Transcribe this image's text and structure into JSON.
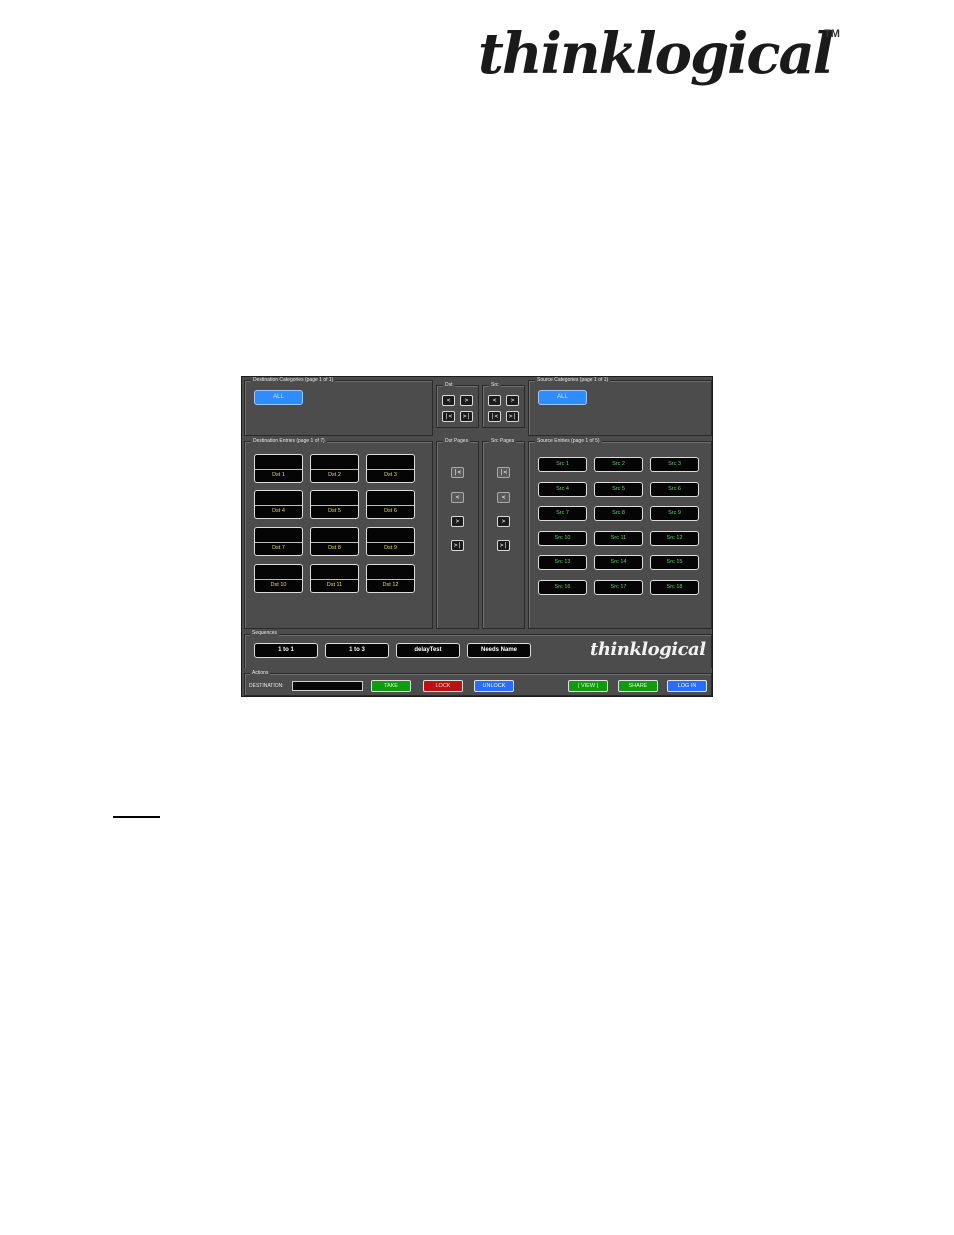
{
  "header": {
    "logo_text": "thinklogical",
    "tm": "TM"
  },
  "app": {
    "dest_categories": {
      "title": "Destination Categories (page 1 of 1)",
      "all_label": "ALL"
    },
    "dst_nav": {
      "title": "Dst",
      "buttons": [
        "<",
        ">",
        "|<",
        ">|"
      ]
    },
    "src_nav": {
      "title": "Src",
      "buttons": [
        "<",
        ">",
        "|<",
        ">|"
      ]
    },
    "source_categories": {
      "title": "Source Categories (page 1 of 1)",
      "all_label": "ALL"
    },
    "dest_entries": {
      "title": "Destination Entries (page 1 of 7)",
      "items": [
        "Dst 1",
        "Dst 2",
        "Dst 3",
        "Dst 4",
        "Dst 5",
        "Dst 6",
        "Dst 7",
        "Dst 8",
        "Dst 9",
        "Dst 10",
        "Dst 11",
        "Dst 12"
      ]
    },
    "dst_pages": {
      "title": "Dst Pages",
      "buttons": [
        "|<",
        "<",
        ">",
        ">|"
      ]
    },
    "src_pages": {
      "title": "Src Pages",
      "buttons": [
        "|<",
        "<",
        ">",
        ">|"
      ]
    },
    "source_entries": {
      "title": "Source Entries (page 1 of 5)",
      "items": [
        "Src 1",
        "Src 2",
        "Src 3",
        "Src 4",
        "Src 5",
        "Src 6",
        "Src 7",
        "Src 8",
        "Src 9",
        "Src 10",
        "Src 11",
        "Src 12",
        "Src 13",
        "Src 14",
        "Src 15",
        "Src 16",
        "Src 17",
        "Src 18"
      ]
    },
    "sequences": {
      "title": "Sequences",
      "items": [
        "1 to 1",
        "1 to 3",
        "delayTest",
        "Needs Name"
      ]
    },
    "brand": {
      "logo_text": "thinklogical",
      "tm": "TM"
    },
    "actions": {
      "title": "Actions",
      "destination_label": "DESTINATION:",
      "take": "TAKE",
      "lock": "LOCK",
      "unlock": "UNLOCK",
      "view": "( VIEW )",
      "share": "SHARE",
      "login": "LOG IN"
    }
  }
}
